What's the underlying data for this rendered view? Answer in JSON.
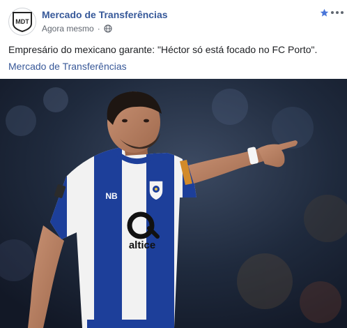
{
  "post": {
    "page_name": "Mercado de Transferências",
    "avatar_text": "MDT",
    "timestamp": "Agora mesmo",
    "separator": "·",
    "audience_icon": "globe-icon",
    "text": "Empresário do mexicano garante: \"Héctor só está focado no FC Porto\".",
    "link_text": "Mercado de Transferências"
  },
  "actions": {
    "star_icon": "star-icon",
    "more_icon": "more-options-icon"
  },
  "photo": {
    "badge_text": "NB",
    "sponsor_text": "altice"
  },
  "colors": {
    "link_blue": "#365899",
    "star_blue": "#4a76d9",
    "jersey_blue": "#1d3f9a"
  }
}
